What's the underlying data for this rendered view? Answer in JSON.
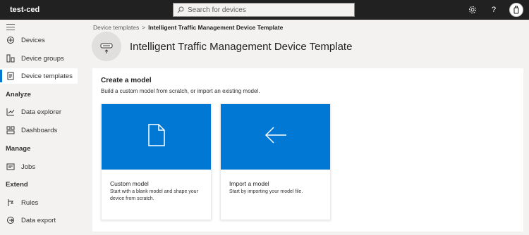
{
  "app": {
    "name": "test-ced"
  },
  "search": {
    "placeholder": "Search for devices"
  },
  "topbar_icons": [
    "gear-icon",
    "help-icon",
    "avatar-icon"
  ],
  "sidebar": {
    "items": [
      {
        "label": "Devices",
        "icon": "devices-icon"
      },
      {
        "label": "Device groups",
        "icon": "device-groups-icon"
      },
      {
        "label": "Device templates",
        "icon": "device-templates-icon",
        "active": true
      }
    ],
    "sections": [
      {
        "title": "Analyze",
        "items": [
          {
            "label": "Data explorer",
            "icon": "chart-icon"
          },
          {
            "label": "Dashboards",
            "icon": "dashboard-icon"
          }
        ]
      },
      {
        "title": "Manage",
        "items": [
          {
            "label": "Jobs",
            "icon": "jobs-icon"
          }
        ]
      },
      {
        "title": "Extend",
        "items": [
          {
            "label": "Rules",
            "icon": "rules-icon"
          },
          {
            "label": "Data export",
            "icon": "export-icon"
          }
        ]
      }
    ]
  },
  "breadcrumb": {
    "parent": "Device templates",
    "separator": ">",
    "current": "Intelligent Traffic Management Device Template"
  },
  "page": {
    "title": "Intelligent Traffic Management Device Template"
  },
  "panel": {
    "title": "Create a model",
    "subtitle": "Build a custom model from scratch, or import an existing model.",
    "cards": [
      {
        "title": "Custom model",
        "description": "Start with a blank model and shape your device from scratch.",
        "icon": "document-icon"
      },
      {
        "title": "Import a model",
        "description": "Start by importing your model file.",
        "icon": "arrow-left-icon"
      }
    ]
  },
  "colors": {
    "topbar": "#212121",
    "accent": "#0078d4",
    "background": "#f3f2f1"
  }
}
